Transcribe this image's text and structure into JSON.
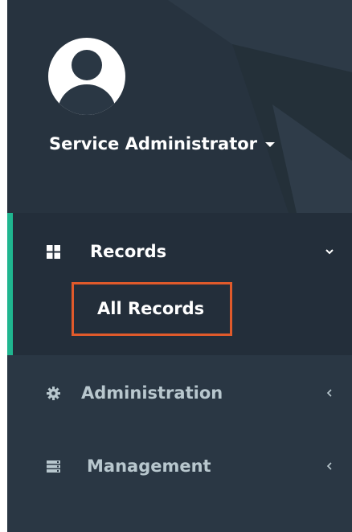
{
  "user": {
    "name": "Service Administrator"
  },
  "menu": {
    "records": {
      "label": "Records",
      "icon": "grid-icon",
      "expanded": true,
      "children": [
        {
          "label": "All Records",
          "highlighted": true
        }
      ]
    },
    "administration": {
      "label": "Administration",
      "icon": "gear-icon",
      "expanded": false
    },
    "management": {
      "label": "Management",
      "icon": "server-icon",
      "expanded": false
    }
  },
  "colors": {
    "sidebar_bg": "#2a3744",
    "active_bg": "#232e3a",
    "active_accent": "#1fb58f",
    "highlight_border": "#e05a2b",
    "inactive_text": "#b8c7ce"
  }
}
